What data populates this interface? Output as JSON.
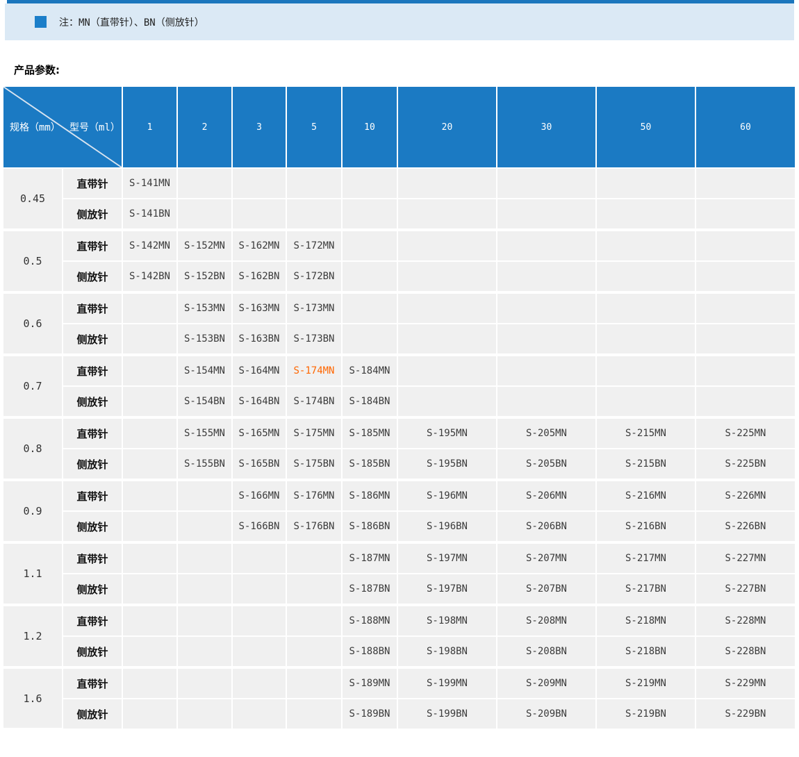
{
  "note": {
    "text": "注：MN（直带针）、BN（侧放针）"
  },
  "section_title": "产品参数:",
  "colors": {
    "top_bar_blue": "#1b76bd",
    "note_band": "#dbe9f5",
    "bullet_blue": "#1b7ec9",
    "header_blue": "#1b7ac3",
    "cell_bg": "#f0f0f0",
    "highlight_orange": "#ff6600"
  },
  "table": {
    "corner": {
      "left": "规格（mm）",
      "right": "型号（ml）"
    },
    "columns": [
      "1",
      "2",
      "3",
      "5",
      "10",
      "20",
      "30",
      "50",
      "60"
    ],
    "row_types": [
      "直带针",
      "侧放针"
    ],
    "highlight": {
      "model": "S-174MN",
      "color": "#ff6600"
    },
    "groups": [
      {
        "spec": "0.45",
        "mn": [
          "S-141MN",
          "",
          "",
          "",
          "",
          "",
          "",
          "",
          ""
        ],
        "bn": [
          "S-141BN",
          "",
          "",
          "",
          "",
          "",
          "",
          "",
          ""
        ]
      },
      {
        "spec": "0.5",
        "mn": [
          "S-142MN",
          "S-152MN",
          "S-162MN",
          "S-172MN",
          "",
          "",
          "",
          "",
          ""
        ],
        "bn": [
          "S-142BN",
          "S-152BN",
          "S-162BN",
          "S-172BN",
          "",
          "",
          "",
          "",
          ""
        ]
      },
      {
        "spec": "0.6",
        "mn": [
          "",
          "S-153MN",
          "S-163MN",
          "S-173MN",
          "",
          "",
          "",
          "",
          ""
        ],
        "bn": [
          "",
          "S-153BN",
          "S-163BN",
          "S-173BN",
          "",
          "",
          "",
          "",
          ""
        ]
      },
      {
        "spec": "0.7",
        "mn": [
          "",
          "S-154MN",
          "S-164MN",
          "S-174MN",
          "S-184MN",
          "",
          "",
          "",
          ""
        ],
        "bn": [
          "",
          "S-154BN",
          "S-164BN",
          "S-174BN",
          "S-184BN",
          "",
          "",
          "",
          ""
        ]
      },
      {
        "spec": "0.8",
        "mn": [
          "",
          "S-155MN",
          "S-165MN",
          "S-175MN",
          "S-185MN",
          "S-195MN",
          "S-205MN",
          "S-215MN",
          "S-225MN"
        ],
        "bn": [
          "",
          "S-155BN",
          "S-165BN",
          "S-175BN",
          "S-185BN",
          "S-195BN",
          "S-205BN",
          "S-215BN",
          "S-225BN"
        ]
      },
      {
        "spec": "0.9",
        "mn": [
          "",
          "",
          "S-166MN",
          "S-176MN",
          "S-186MN",
          "S-196MN",
          "S-206MN",
          "S-216MN",
          "S-226MN"
        ],
        "bn": [
          "",
          "",
          "S-166BN",
          "S-176BN",
          "S-186BN",
          "S-196BN",
          "S-206BN",
          "S-216BN",
          "S-226BN"
        ]
      },
      {
        "spec": "1.1",
        "mn": [
          "",
          "",
          "",
          "",
          "S-187MN",
          "S-197MN",
          "S-207MN",
          "S-217MN",
          "S-227MN"
        ],
        "bn": [
          "",
          "",
          "",
          "",
          "S-187BN",
          "S-197BN",
          "S-207BN",
          "S-217BN",
          "S-227BN"
        ]
      },
      {
        "spec": "1.2",
        "mn": [
          "",
          "",
          "",
          "",
          "S-188MN",
          "S-198MN",
          "S-208MN",
          "S-218MN",
          "S-228MN"
        ],
        "bn": [
          "",
          "",
          "",
          "",
          "S-188BN",
          "S-198BN",
          "S-208BN",
          "S-218BN",
          "S-228BN"
        ]
      },
      {
        "spec": "1.6",
        "mn": [
          "",
          "",
          "",
          "",
          "S-189MN",
          "S-199MN",
          "S-209MN",
          "S-219MN",
          "S-229MN"
        ],
        "bn": [
          "",
          "",
          "",
          "",
          "S-189BN",
          "S-199BN",
          "S-209BN",
          "S-219BN",
          "S-229BN"
        ]
      }
    ]
  }
}
